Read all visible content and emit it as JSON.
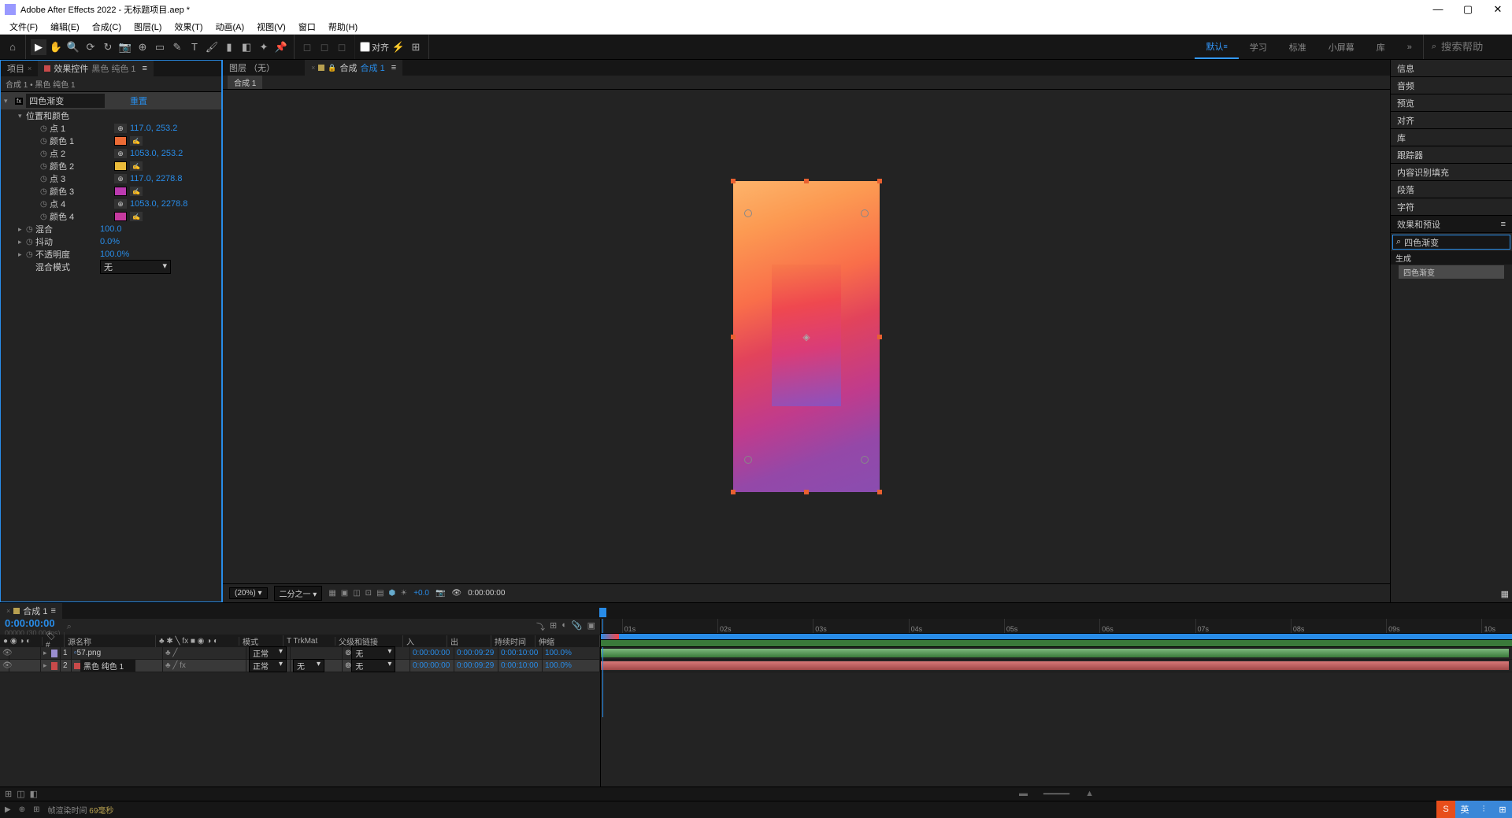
{
  "titlebar": {
    "app": "Adobe After Effects 2022",
    "sep": " - ",
    "project": "无标题项目.aep *"
  },
  "menu": [
    "文件(F)",
    "编辑(E)",
    "合成(C)",
    "图层(L)",
    "效果(T)",
    "动画(A)",
    "视图(V)",
    "窗口",
    "帮助(H)"
  ],
  "toolbar": {
    "align_label": "对齐",
    "workspaces": [
      "默认",
      "学习",
      "标准",
      "小屏幕",
      "库"
    ],
    "more": "»",
    "search_placeholder": "搜索帮助"
  },
  "left": {
    "tabs": {
      "project": "项目",
      "effects_prefix": "效果控件",
      "effects_layer": "黑色 纯色 1",
      "menu_glyph": "≡"
    },
    "breadcrumb": "合成 1 • 黑色 纯色 1",
    "fx": {
      "name": "四色渐变",
      "reset": "重置",
      "group_pos_color": "位置和颜色",
      "points": [
        {
          "label": "点 1",
          "value": "117.0, 253.2"
        },
        {
          "label": "点 2",
          "value": "1053.0, 253.2"
        },
        {
          "label": "点 3",
          "value": "117.0, 2278.8"
        },
        {
          "label": "点 4",
          "value": "1053.0, 2278.8"
        }
      ],
      "colors": [
        {
          "label": "颜色 1",
          "hex": "#ec6b35"
        },
        {
          "label": "颜色 2",
          "hex": "#eabb3a"
        },
        {
          "label": "颜色 3",
          "hex": "#bb3ab0"
        },
        {
          "label": "颜色 4",
          "hex": "#c63a9f"
        }
      ],
      "params": [
        {
          "label": "混合",
          "value": "100.0"
        },
        {
          "label": "抖动",
          "value": "0.0%"
        },
        {
          "label": "不透明度",
          "value": "100.0%"
        }
      ],
      "blend_mode_label": "混合模式",
      "blend_mode_value": "无"
    }
  },
  "center": {
    "tabs": {
      "layer": "图层 （无）",
      "comp_prefix": "合成",
      "comp_name": "合成 1",
      "menu_glyph": "≡"
    },
    "subtab": "合成 1",
    "controls": {
      "zoom": "(20%)",
      "res": "二分之一",
      "offset": "+0.0",
      "time": "0:00:00:00"
    }
  },
  "right": {
    "items": [
      "信息",
      "音频",
      "预览",
      "对齐",
      "库",
      "跟踪器",
      "内容识别填充",
      "段落",
      "字符"
    ],
    "presets_label": "效果和预设",
    "search_value": "四色渐变",
    "result_category": "生成",
    "result_item": "四色渐变"
  },
  "timeline": {
    "tab_icon_glyph": "■",
    "tab": "合成 1",
    "timecode": "0:00:00:00",
    "frames": "00000 (30.00 fps)",
    "search_placeholder": "⌕",
    "columns": {
      "switches": "● ◉ ◑ ◐",
      "num": "#",
      "name": "源名称",
      "flags": "♣ ✱ ╲ fx ■ ◉ ◑ ◐",
      "mode": "模式",
      "trkmat": "T  TrkMat",
      "parent": "父级和链接",
      "in": "入",
      "out": "出",
      "dur": "持续时间",
      "stretch": "伸缩"
    },
    "ruler": [
      "01s",
      "02s",
      "03s",
      "04s",
      "05s",
      "06s",
      "07s",
      "08s",
      "09s",
      "10s"
    ],
    "layers": [
      {
        "num": "1",
        "name": "57.png",
        "label": "#9a8ed0",
        "mode": "正常",
        "trkmat": "",
        "parent": "无",
        "in": "0:00:00:00",
        "out": "0:00:09:29",
        "dur": "0:00:10:00",
        "stretch": "100.0%",
        "bar": "green",
        "selected": false,
        "name_boxed": false
      },
      {
        "num": "2",
        "name": "黑色 纯色 1",
        "label": "#c84a4a",
        "mode": "正常",
        "trkmat": "无",
        "parent": "无",
        "in": "0:00:00:00",
        "out": "0:00:09:29",
        "dur": "0:00:10:00",
        "stretch": "100.0%",
        "bar": "red",
        "selected": true,
        "name_boxed": true
      }
    ]
  },
  "status": {
    "render_label": "帧渲染时间",
    "render_value": "69毫秒"
  },
  "ime": {
    "logo": "S",
    "lang": "英"
  }
}
